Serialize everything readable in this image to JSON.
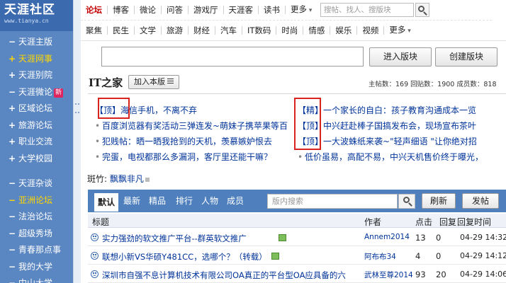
{
  "sidebar": {
    "logo_title": "天涯社区",
    "logo_url": "www.tianya.cn",
    "groups": [
      [
        {
          "mark": "−",
          "label": "天涯主版"
        },
        {
          "mark": "+",
          "label": "天涯网事",
          "highlight": true
        },
        {
          "mark": "+",
          "label": "天涯别院"
        },
        {
          "mark": "−",
          "label": "天涯微论",
          "badge": "新"
        },
        {
          "mark": "+",
          "label": "区域论坛"
        },
        {
          "mark": "+",
          "label": "旅游论坛"
        },
        {
          "mark": "+",
          "label": "职业交流"
        },
        {
          "mark": "+",
          "label": "大学校园"
        }
      ],
      [
        {
          "mark": "−",
          "label": "天涯杂谈"
        },
        {
          "mark": "−",
          "label": "亚洲论坛",
          "highlight": true
        },
        {
          "mark": "−",
          "label": "法治论坛"
        },
        {
          "mark": "−",
          "label": "超级秀场"
        },
        {
          "mark": "−",
          "label": "青春那点事"
        },
        {
          "mark": "−",
          "label": "我的大学"
        },
        {
          "mark": "−",
          "label": "中山大学"
        }
      ]
    ]
  },
  "topnav": {
    "row1": [
      "论坛",
      "博客",
      "微论",
      "问答",
      "游戏厅",
      "天涯客",
      "读书",
      "更多"
    ],
    "row2": [
      "聚焦",
      "民生",
      "文学",
      "旅游",
      "财经",
      "汽车",
      "IT数码",
      "时尚",
      "情感",
      "娱乐",
      "视频",
      "更多"
    ],
    "search_placeholder": "搜帖、找人、搜版块"
  },
  "board_search": {
    "enter_label": "进入版块",
    "create_label": "创建版块"
  },
  "board": {
    "title": "IT之家",
    "join_label": "加入本版",
    "stats": "主帖数：169  回贴数：1900  成员数：818"
  },
  "featured": {
    "left": [
      {
        "tag": "【顶】",
        "text": "海信手机，不离不弃"
      },
      {
        "tag": "",
        "text": "百度浏览器有奖活动三弹连发~萌妹子携苹果等百"
      },
      {
        "tag": "",
        "text": "犯贱帖：晒一晒我抢到的天机，羡慕嫉妒恨去"
      },
      {
        "tag": "",
        "text": "完蛋，电视都那么多漏洞，客厅里还能干嘛？"
      }
    ],
    "right": [
      {
        "tag": "【精】",
        "text": "一个家长的自白：孩子教育沟通成本一览"
      },
      {
        "tag": "【顶】",
        "text": "中兴赶赴棒子国搞发布会，现场宣布茶叶"
      },
      {
        "tag": "【顶】",
        "text": "一大波蛛纸来袭~\"轻声细语 \"让你绝对招"
      },
      {
        "tag": "",
        "text": "低价虽易，高配不易，中兴天机售价终于曝光，"
      }
    ]
  },
  "moderators": {
    "label": "斑竹:",
    "name": "飘飘非凡"
  },
  "tabs": [
    "默认",
    "最新",
    "精品",
    "排行",
    "人物",
    "成员"
  ],
  "toolbar": {
    "search_placeholder": "版内搜索",
    "refresh_label": "刷新",
    "post_label": "发帖"
  },
  "thread_table": {
    "headers": {
      "title": "标题",
      "author": "作者",
      "clicks": "点击",
      "replies": "回复",
      "time": "回复时间"
    },
    "rows": [
      {
        "title": "实力强劲的软文推广平台--群英软文推广",
        "author": "Annem2014",
        "clicks": "13",
        "replies": "0",
        "time": "04-29 14:32"
      },
      {
        "title": "联想小新VS华硕Y481CC，选哪个？（转载）",
        "author": "阿布布34",
        "clicks": "4",
        "replies": "0",
        "time": "04-29 14:12"
      },
      {
        "title": "深圳市自强不息计算机技术有限公司OA真正的平台型OA应具备的六",
        "author": "武林至尊2014",
        "clicks": "93",
        "replies": "20",
        "time": "04-29 14:06"
      }
    ]
  }
}
